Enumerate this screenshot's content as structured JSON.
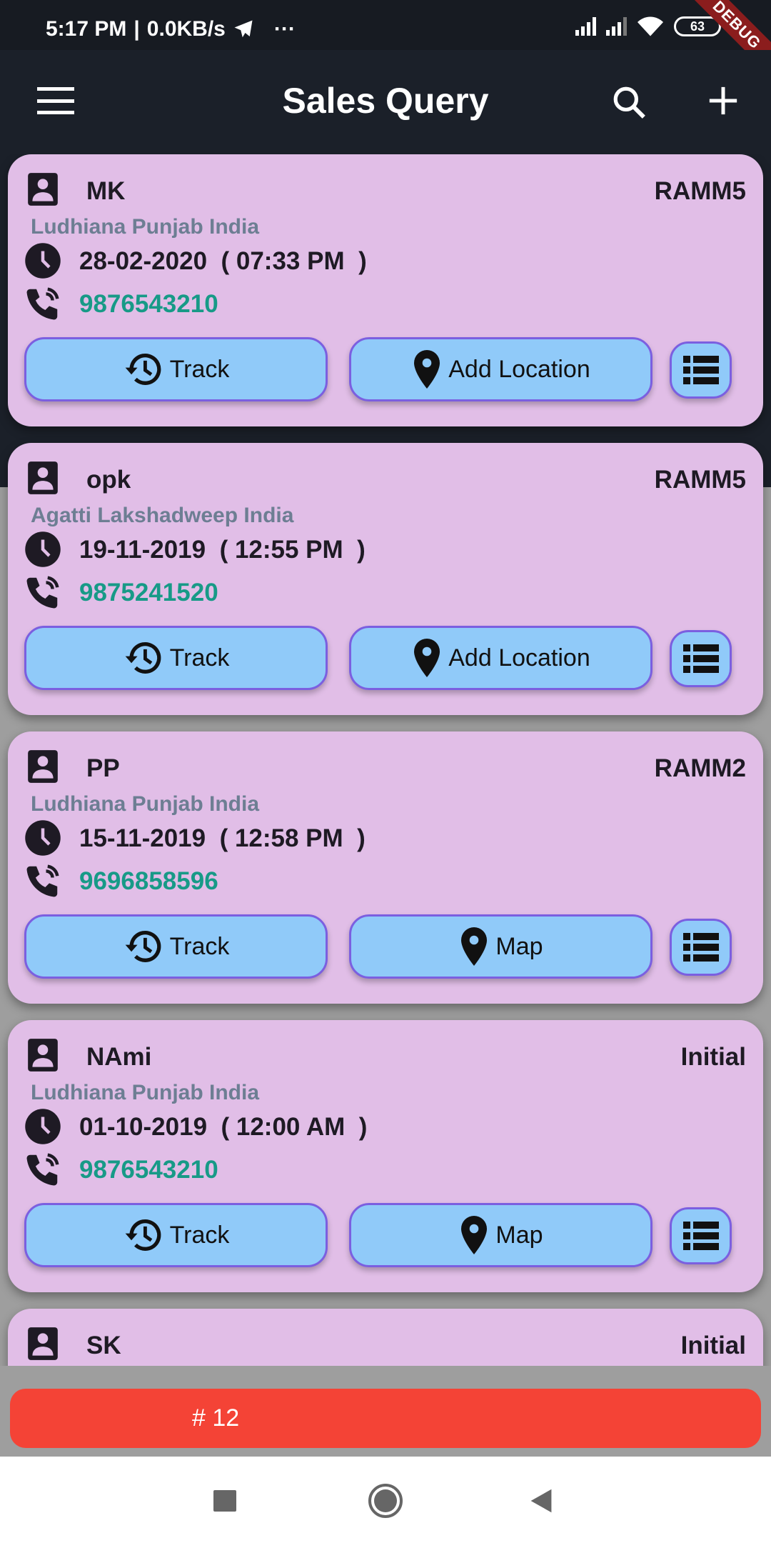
{
  "status_bar": {
    "time": "5:17 PM",
    "speed": "0.0KB/s",
    "more": "···",
    "battery": "63",
    "debug_banner": "DEBUG"
  },
  "app_bar": {
    "title": "Sales Query",
    "icons": [
      "menu-icon",
      "search-icon",
      "add-icon"
    ]
  },
  "cards": [
    {
      "name": "MK",
      "status": "RAMM5",
      "location": "Ludhiana Punjab India",
      "date": "28-02-2020",
      "time": "( 07:33 PM  )",
      "phone": "9876543210",
      "track_label": "Track",
      "location_button_label": "Add Location"
    },
    {
      "name": "opk",
      "status": "RAMM5",
      "location": "Agatti Lakshadweep India",
      "date": "19-11-2019",
      "time": "( 12:55 PM  )",
      "phone": "9875241520",
      "track_label": "Track",
      "location_button_label": "Add Location"
    },
    {
      "name": "PP",
      "status": "RAMM2",
      "location": "Ludhiana Punjab India",
      "date": "15-11-2019",
      "time": "( 12:58 PM  )",
      "phone": "9696858596",
      "track_label": "Track",
      "location_button_label": "Map"
    },
    {
      "name": "NAmi",
      "status": "Initial",
      "location": "Ludhiana Punjab India",
      "date": "01-10-2019",
      "time": "( 12:00 AM  )",
      "phone": "9876543210",
      "track_label": "Track",
      "location_button_label": "Map"
    },
    {
      "name": "SK",
      "status": "Initial",
      "location": "",
      "date": "",
      "time": "",
      "phone": "",
      "track_label": "",
      "location_button_label": ""
    }
  ],
  "count_bar": {
    "label": "# 12"
  },
  "colors": {
    "card": "#e1bee7",
    "button": "#90caf9",
    "button_border": "#7b5fe0",
    "phone": "#179a87",
    "location": "#6d7e93",
    "count_bar": "#f44336",
    "app_bar": "#1b2029"
  }
}
